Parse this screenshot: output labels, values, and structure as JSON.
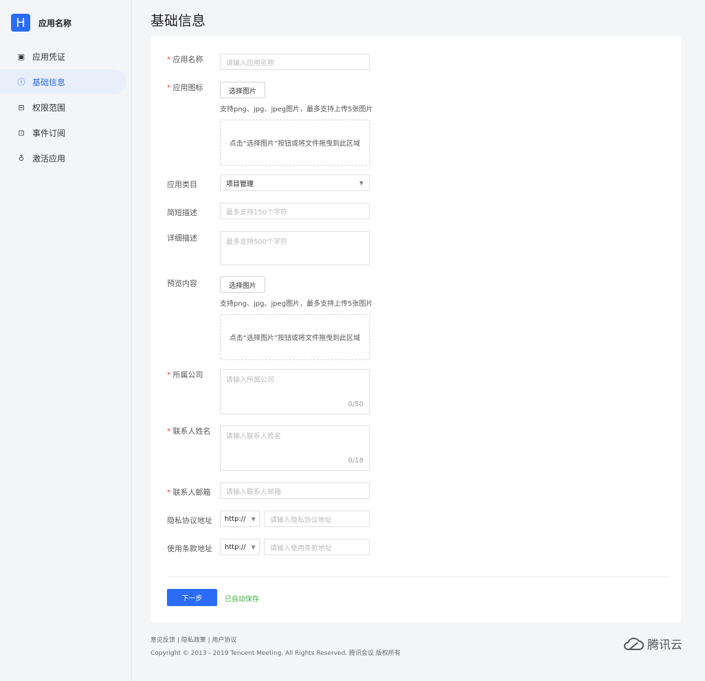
{
  "app": {
    "logo_letter": "H",
    "name": "应用名称"
  },
  "nav": {
    "items": [
      {
        "icon": "▣",
        "label": "应用凭证"
      },
      {
        "icon": "ⓘ",
        "label": "基础信息"
      },
      {
        "icon": "⊟",
        "label": "权限范围"
      },
      {
        "icon": "⊡",
        "label": "事件订阅"
      },
      {
        "icon": "♁",
        "label": "激活应用"
      }
    ]
  },
  "page": {
    "title": "基础信息"
  },
  "form": {
    "required_mark": "*",
    "app_name": {
      "label": "应用名称",
      "placeholder": "请输入应用名称"
    },
    "app_icon": {
      "label": "应用图标",
      "button": "选择图片",
      "hint": "支持png、jpg、jpeg图片，最多支持上传5张图片",
      "dropzone": "点击“选择图片”按钮或将文件拖曳到此区域"
    },
    "category": {
      "label": "应用类目",
      "value": "项目管理"
    },
    "short_desc": {
      "label": "简短描述",
      "placeholder": "最多支持150个字符"
    },
    "long_desc": {
      "label": "详细描述",
      "placeholder": "最多支持500个字符"
    },
    "preview": {
      "label": "预览内容",
      "button": "选择图片",
      "hint": "支持png、jpg、jpeg图片，最多支持上传5张图片",
      "dropzone": "点击“选择图片”按钮或将文件拖曳到此区域"
    },
    "company": {
      "label": "所属公司",
      "placeholder": "请输入所属公司",
      "counter": "0/50"
    },
    "contact_name": {
      "label": "联系人姓名",
      "placeholder": "请输入联系人姓名",
      "counter": "0/18"
    },
    "contact_email": {
      "label": "联系人邮箱",
      "placeholder": "请输入联系人邮箱"
    },
    "privacy_url": {
      "label": "隐私协议地址",
      "protocol": "http://",
      "placeholder": "请输入隐私协议地址"
    },
    "terms_url": {
      "label": "使用条款地址",
      "protocol": "http://",
      "placeholder": "请输入使用条款地址"
    },
    "next_button": "下一步",
    "autosave": "已自动保存"
  },
  "footer": {
    "links": "意见反馈 | 隐私政策 | 用户协议",
    "copyright": "Copyright © 2013 - 2019 Tencent Meeting. All Rights Reserved.  腾讯会议 版权所有",
    "brand": "腾讯云"
  },
  "colors": {
    "accent": "#2b6cf6",
    "required": "#e54545",
    "success": "#3bb13b"
  }
}
